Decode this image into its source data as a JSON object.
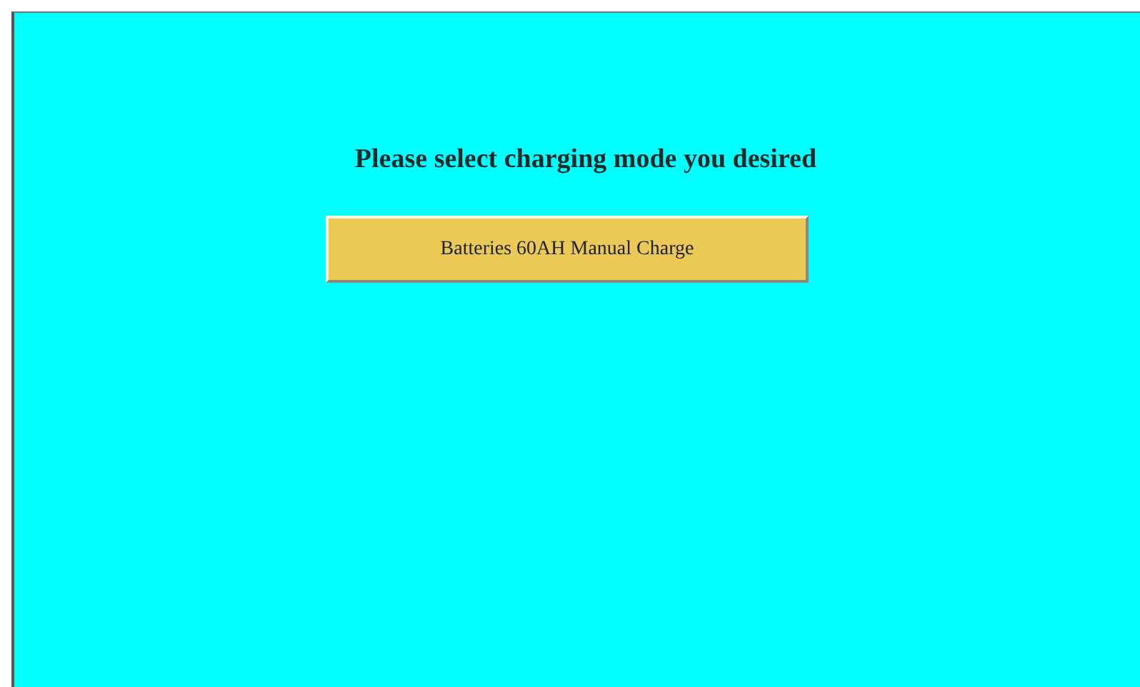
{
  "heading": "Please select charging mode you desired",
  "buttons": [
    {
      "label": "Batteries 60AH Manual Charge"
    }
  ]
}
